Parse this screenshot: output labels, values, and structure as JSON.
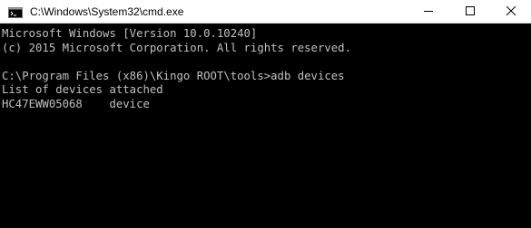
{
  "window": {
    "title": "C:\\Windows\\System32\\cmd.exe",
    "app_icon": "cmd-icon",
    "controls": {
      "minimize_icon": "minimize-icon",
      "maximize_icon": "maximize-icon",
      "close_icon": "close-icon"
    }
  },
  "console": {
    "colors": {
      "background": "#000000",
      "text": "#c0c0c0"
    },
    "lines": [
      "Microsoft Windows [Version 10.0.10240]",
      "(c) 2015 Microsoft Corporation. All rights reserved.",
      "",
      "C:\\Program Files (x86)\\Kingo ROOT\\tools>adb devices",
      "List of devices attached",
      "HC47EWW05068    device"
    ]
  }
}
